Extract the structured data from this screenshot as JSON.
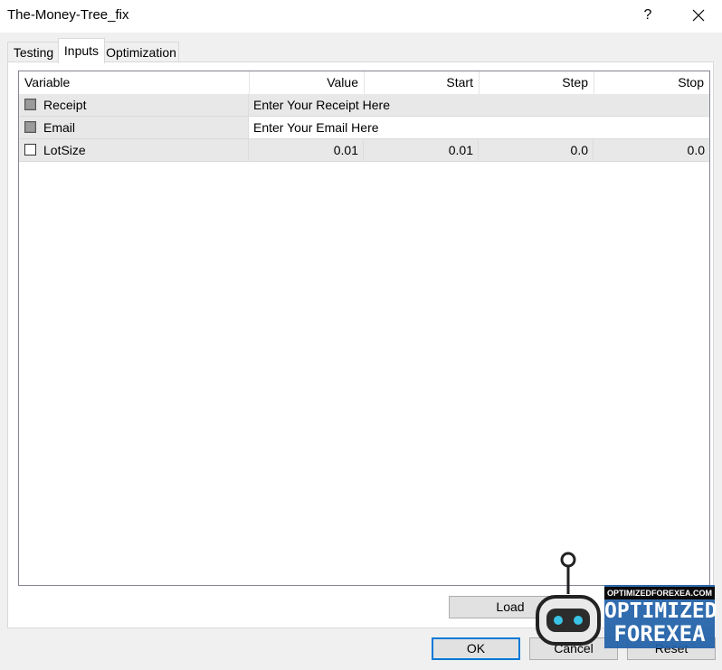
{
  "window": {
    "title": "The-Money-Tree_fix",
    "help_label": "?",
    "close_icon": "close-icon"
  },
  "tabs": [
    {
      "label": "Testing",
      "active": false
    },
    {
      "label": "Inputs",
      "active": true
    },
    {
      "label": "Optimization",
      "active": false
    }
  ],
  "grid": {
    "columns": [
      "Variable",
      "Value",
      "Start",
      "Step",
      "Stop"
    ],
    "rows": [
      {
        "variable": "Receipt",
        "checked": true,
        "value": "Enter Your Receipt Here",
        "start": "",
        "step": "",
        "stop": ""
      },
      {
        "variable": "Email",
        "checked": true,
        "value": "Enter Your Email Here",
        "start": "",
        "step": "",
        "stop": ""
      },
      {
        "variable": "LotSize",
        "checked": false,
        "value": "0.01",
        "start": "0.01",
        "step": "0.0",
        "stop": "0.0"
      }
    ]
  },
  "buttons": {
    "load": "Load",
    "ok": "OK",
    "cancel": "Cancel",
    "reset": "Reset"
  },
  "watermark": {
    "top_text": "OPTIMIZEDFOREXEA.COM",
    "line1": "OPTIMIZED",
    "line2": "FOREXEA"
  },
  "colors": {
    "accent": "#0078d7",
    "watermark_blue": "#1f5fa8"
  }
}
